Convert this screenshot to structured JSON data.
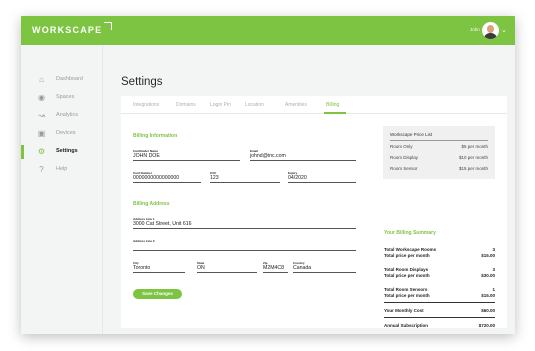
{
  "app": {
    "logo": "WORKSCAPE"
  },
  "user": {
    "name": "John"
  },
  "sidebar": {
    "items": [
      {
        "label": "Dashboard",
        "icon": "house-icon"
      },
      {
        "label": "Spaces",
        "icon": "location-pin-icon"
      },
      {
        "label": "Analytics",
        "icon": "line-chart-icon"
      },
      {
        "label": "Devices",
        "icon": "device-icon"
      },
      {
        "label": "Settings",
        "icon": "gear-icon"
      },
      {
        "label": "Help",
        "icon": "question-icon"
      }
    ]
  },
  "page": {
    "title": "Settings"
  },
  "tabs": [
    "Integrations",
    "Domains",
    "Login Pin",
    "Location",
    "Amenities",
    "Billing"
  ],
  "billing_info": {
    "title": "Billing Information",
    "cardholder_label": "Cardholder Name",
    "cardholder_value": "JOHN DOE",
    "email_label": "Email",
    "email_value": "johnd@inc.com",
    "card_number_label": "Card Number",
    "card_number_value": "0000000000000000",
    "cvc_label": "CVC",
    "cvc_value": "123",
    "expiry_label": "Expiry",
    "expiry_value": "04/2020"
  },
  "billing_address": {
    "title": "Billing Address",
    "line1_label": "Address Line 1",
    "line1_value": "3000 Cat Street, Unit 616",
    "line2_label": "Address Line 2",
    "line2_value": "",
    "city_label": "City",
    "city_value": "Toronto",
    "state_label": "State",
    "state_value": "ON",
    "zip_label": "Zip",
    "zip_value": "M2M4C8",
    "country_label": "Country",
    "country_value": "Canada"
  },
  "save_button": "Save Changes",
  "price_list": {
    "title": "Workscape Price List",
    "rows": [
      {
        "label": "Room Only",
        "price": "$5 per month"
      },
      {
        "label": "Room Display",
        "price": "$10 per month"
      },
      {
        "label": "Room Sensor",
        "price": "$15 per month"
      }
    ]
  },
  "summary": {
    "title": "Your Billing Summary",
    "rows": [
      {
        "label": "Total Workscape Rooms",
        "value": "3"
      },
      {
        "label": "Total price per month",
        "value": "$15.00"
      },
      {
        "label": "Total Room Displays",
        "value": "3"
      },
      {
        "label": "Total price per month",
        "value": "$30.00"
      },
      {
        "label": "Total Room Sensors",
        "value": "1"
      },
      {
        "label": "Total price per month",
        "value": "$15.00"
      }
    ],
    "monthly_label": "Your Monthly Cost",
    "monthly_value": "$60.00",
    "annual_label": "Annual Subscription",
    "annual_value": "$720.00"
  },
  "colors": {
    "accent": "#7ec443",
    "background": "#f3f4f4"
  }
}
